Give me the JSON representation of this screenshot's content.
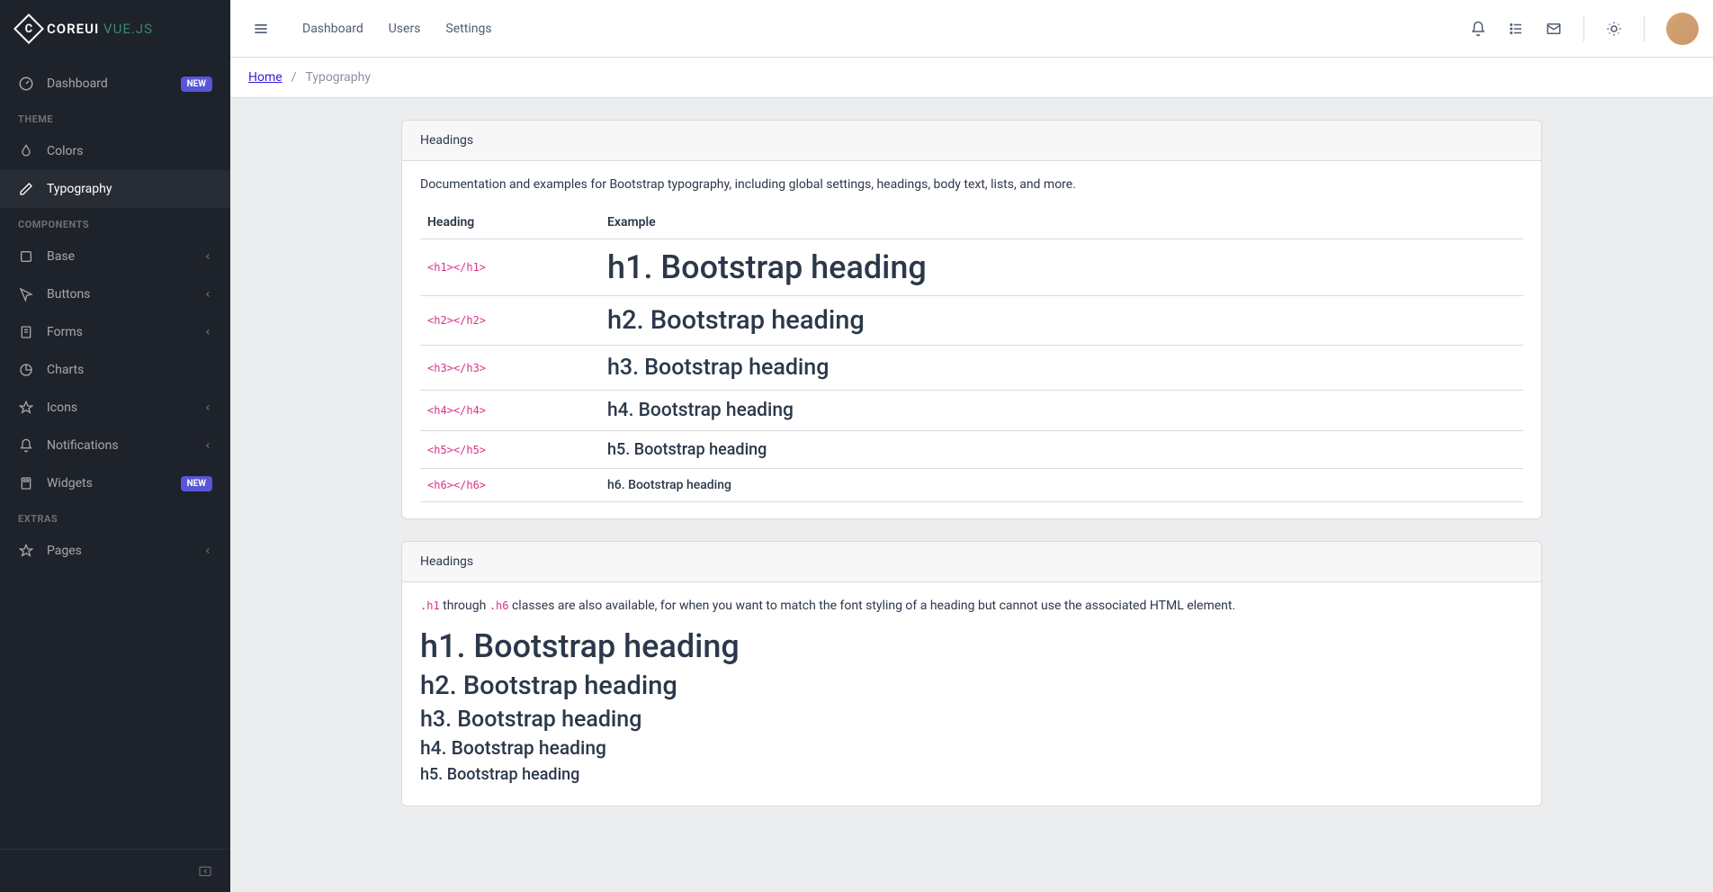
{
  "brand": {
    "name": "COREUI",
    "suffix": "VUE.JS"
  },
  "sidebar": {
    "dashboard": {
      "label": "Dashboard",
      "badge": "NEW"
    },
    "titles": {
      "theme": "THEME",
      "components": "COMPONENTS",
      "extras": "EXTRAS"
    },
    "theme": [
      {
        "label": "Colors"
      },
      {
        "label": "Typography"
      }
    ],
    "components": [
      {
        "label": "Base"
      },
      {
        "label": "Buttons"
      },
      {
        "label": "Forms"
      },
      {
        "label": "Charts"
      },
      {
        "label": "Icons"
      },
      {
        "label": "Notifications"
      },
      {
        "label": "Widgets",
        "badge": "NEW"
      }
    ],
    "extras": [
      {
        "label": "Pages"
      }
    ]
  },
  "header": {
    "nav": [
      {
        "label": "Dashboard"
      },
      {
        "label": "Users"
      },
      {
        "label": "Settings"
      }
    ]
  },
  "breadcrumb": {
    "home": "Home",
    "sep": "/",
    "current": "Typography"
  },
  "card1": {
    "title": "Headings",
    "desc": "Documentation and examples for Bootstrap typography, including global settings, headings, body text, lists, and more.",
    "th1": "Heading",
    "th2": "Example",
    "rows": [
      {
        "tag": "<h1></h1>",
        "text": "h1. Bootstrap heading",
        "cls": "h1"
      },
      {
        "tag": "<h2></h2>",
        "text": "h2. Bootstrap heading",
        "cls": "h2"
      },
      {
        "tag": "<h3></h3>",
        "text": "h3. Bootstrap heading",
        "cls": "h3"
      },
      {
        "tag": "<h4></h4>",
        "text": "h4. Bootstrap heading",
        "cls": "h4"
      },
      {
        "tag": "<h5></h5>",
        "text": "h5. Bootstrap heading",
        "cls": "h5"
      },
      {
        "tag": "<h6></h6>",
        "text": "h6. Bootstrap heading",
        "cls": "h6"
      }
    ]
  },
  "card2": {
    "title": "Headings",
    "code1": ".h1",
    "mid": " through ",
    "code2": ".h6",
    "rest": " classes are also available, for when you want to match the font styling of a heading but cannot use the associated HTML element.",
    "items": [
      {
        "text": "h1. Bootstrap heading",
        "cls": "h1"
      },
      {
        "text": "h2. Bootstrap heading",
        "cls": "h2"
      },
      {
        "text": "h3. Bootstrap heading",
        "cls": "h3"
      },
      {
        "text": "h4. Bootstrap heading",
        "cls": "h4"
      },
      {
        "text": "h5. Bootstrap heading",
        "cls": "h5"
      }
    ]
  }
}
